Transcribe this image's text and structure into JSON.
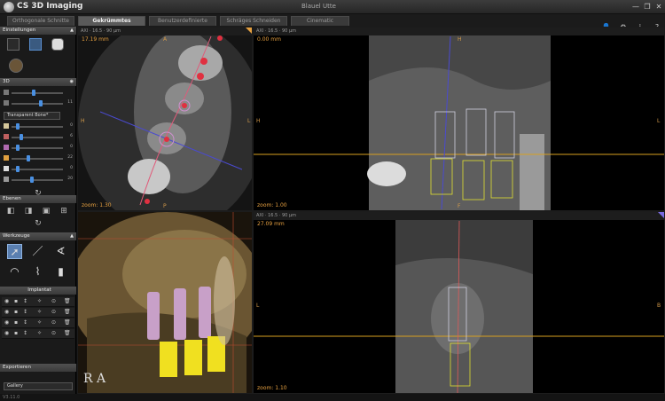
{
  "window": {
    "app_title": "CS 3D Imaging",
    "patient": "Blauel Utte",
    "minimize": "—",
    "maximize": "❐",
    "close": "✕"
  },
  "tabs": [
    {
      "label": "Orthogonale Schnitte",
      "active": false
    },
    {
      "label": "Gekrümmtes Schneiden",
      "active": true
    },
    {
      "label": "Benutzerdefinierte Schnitte",
      "active": false
    },
    {
      "label": "Schräges Schneiden",
      "active": false
    },
    {
      "label": "Cinematic",
      "active": false
    }
  ],
  "toolbar_icons": [
    "user-icon",
    "settings-icon",
    "info-icon",
    "help-icon"
  ],
  "left": {
    "einstellungen": "Einstellungen",
    "section_3d": "3D",
    "slider_values": [
      "",
      "11",
      "0",
      "6",
      "0",
      "22",
      "0",
      "20"
    ],
    "render_mode": "Transparent Bone*",
    "ebenen": "Ebenen",
    "werkzeuge": "Werkzeuge",
    "implantat": "Implantat",
    "exportieren": "Exportieren",
    "gallery": "Gallery"
  },
  "viewports": {
    "axial": {
      "measure": "17.19 mm",
      "zoom": "zoom: 1.30",
      "bar": "AXI · 16.5 · 90 μm",
      "top": "A",
      "bottom": "P",
      "left": "H",
      "right": "L"
    },
    "cross1": {
      "measure": "0.00 mm",
      "zoom": "zoom: 1.00",
      "bar": "AXI · 16.5 · 90 μm",
      "top": "H",
      "bottom": "F",
      "left": "H",
      "right": "L"
    },
    "render3d": {
      "labels": "R A"
    },
    "cross2": {
      "measure": "27.09 mm",
      "zoom": "zoom: 1.10",
      "bar": "AXI · 16.5 · 90 μm",
      "left": "L",
      "right": "B"
    }
  },
  "status": "V3.11.0"
}
